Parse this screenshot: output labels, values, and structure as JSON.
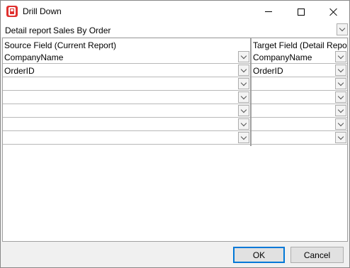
{
  "window": {
    "title": "Drill Down",
    "app_icon": "report-app-icon"
  },
  "detail": {
    "label": "Detail report",
    "value": "Sales By Order"
  },
  "grid": {
    "source_header": "Source Field (Current Report)",
    "target_header": "Target Field (Detail Report)",
    "rows": [
      {
        "source": "CompanyName",
        "target": "CompanyName"
      },
      {
        "source": "OrderID",
        "target": "OrderID"
      },
      {
        "source": "",
        "target": ""
      },
      {
        "source": "",
        "target": ""
      },
      {
        "source": "",
        "target": ""
      },
      {
        "source": "",
        "target": ""
      },
      {
        "source": "",
        "target": ""
      }
    ]
  },
  "footer": {
    "ok_label": "OK",
    "cancel_label": "Cancel"
  }
}
